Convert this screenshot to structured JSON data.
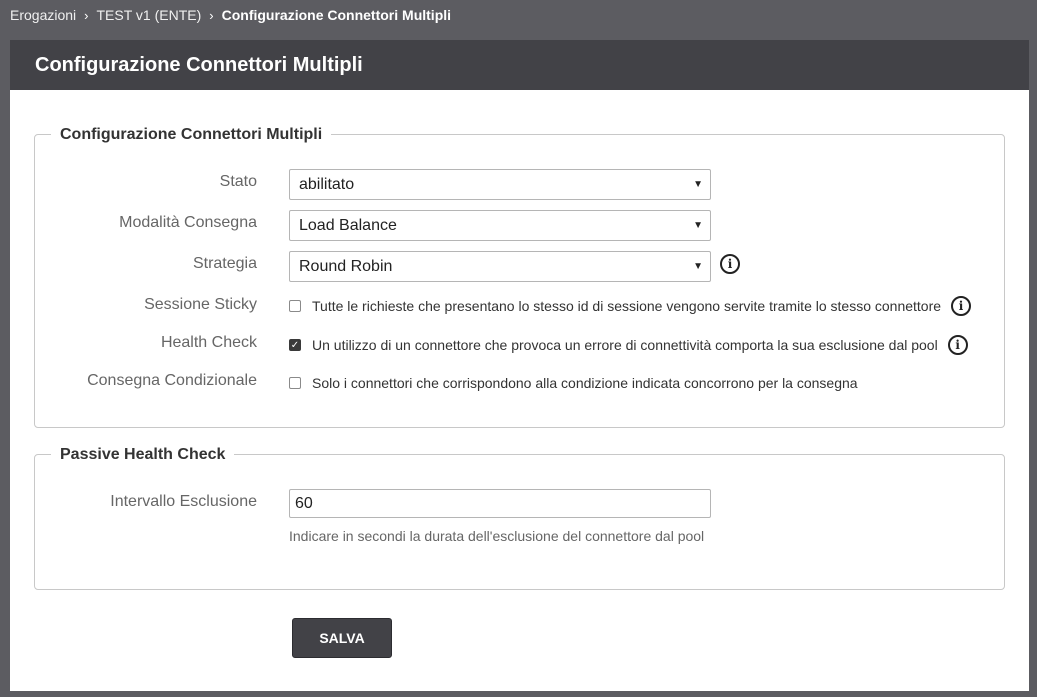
{
  "breadcrumb": {
    "items": [
      "Erogazioni",
      "TEST v1 (ENTE)"
    ],
    "current": "Configurazione Connettori Multipli"
  },
  "panel": {
    "title": "Configurazione Connettori Multipli"
  },
  "section1": {
    "legend": "Configurazione Connettori Multipli",
    "stato": {
      "label": "Stato",
      "value": "abilitato"
    },
    "modalita": {
      "label": "Modalità Consegna",
      "value": "Load Balance"
    },
    "strategia": {
      "label": "Strategia",
      "value": "Round Robin"
    },
    "sessione": {
      "label": "Sessione Sticky",
      "checked": false,
      "text": "Tutte le richieste che presentano lo stesso id di sessione vengono servite tramite lo stesso connettore"
    },
    "health": {
      "label": "Health Check",
      "checked": true,
      "text": "Un utilizzo di un connettore che provoca un errore di connettività comporta la sua esclusione dal pool"
    },
    "condizionale": {
      "label": "Consegna Condizionale",
      "checked": false,
      "text": "Solo i connettori che corrispondono alla condizione indicata concorrono per la consegna"
    }
  },
  "section2": {
    "legend": "Passive Health Check",
    "intervallo": {
      "label": "Intervallo Esclusione",
      "value": "60",
      "help": "Indicare in secondi la durata dell'esclusione del connettore dal pool"
    }
  },
  "actions": {
    "save_label": "SALVA"
  },
  "icons": {
    "breadcrumb_separator": "chevron-right-icon",
    "select_caret": "caret-down-icon",
    "info": "info-icon",
    "check": "checkmark-icon"
  },
  "colors": {
    "page_background": "#5c5c61",
    "header_background": "#424247",
    "button_background": "#424247"
  }
}
